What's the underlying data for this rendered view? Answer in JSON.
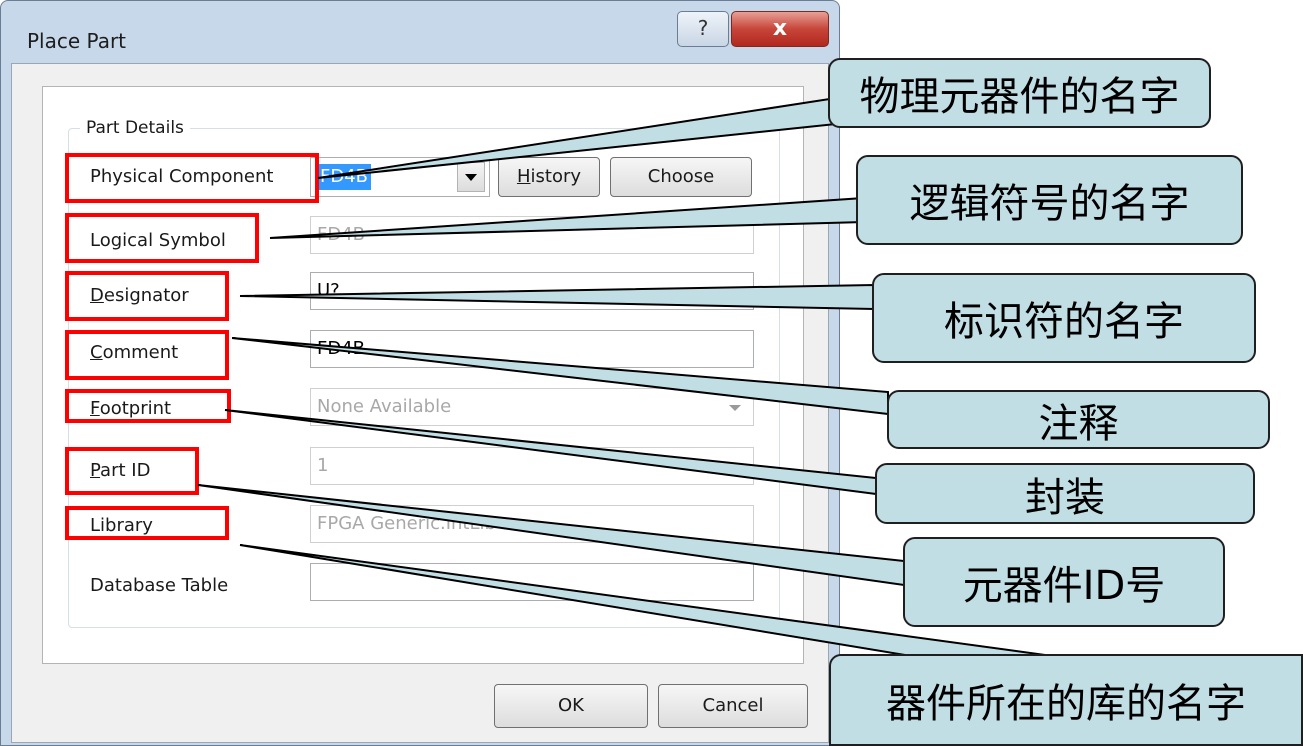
{
  "dialog": {
    "title": "Place Part",
    "help_label": "?",
    "close_label": "x",
    "group_title": "Part Details",
    "physical_component": {
      "label": "Physical Component",
      "value": "FD4B"
    },
    "history_button": {
      "key": "H",
      "rest": "istory"
    },
    "choose_button": "Choose",
    "logical_symbol": {
      "label": "Logical Symbol",
      "value": "FD4B"
    },
    "designator": {
      "key": "D",
      "rest": "esignator",
      "value": "U?"
    },
    "comment": {
      "key": "C",
      "rest": "omment",
      "value": "FD4B"
    },
    "footprint": {
      "key": "F",
      "rest": "ootprint",
      "value": "None Available"
    },
    "part_id": {
      "key": "P",
      "rest": "art ID",
      "value": "1"
    },
    "library": {
      "label": "Library",
      "value": "FPGA Generic.IntLib"
    },
    "database_table": {
      "label": "Database Table",
      "value": ""
    },
    "ok_button": "OK",
    "cancel_button": "Cancel"
  },
  "annotations": [
    "物理元器件的名字",
    "逻辑符号的名字",
    "标识符的名字",
    "注释",
    "封装",
    "元器件ID号",
    "器件所在的库的名字"
  ],
  "colors": {
    "highlight_box": "#ff0000",
    "callout_fill": "#c2dee5",
    "selection": "#3399ff"
  }
}
